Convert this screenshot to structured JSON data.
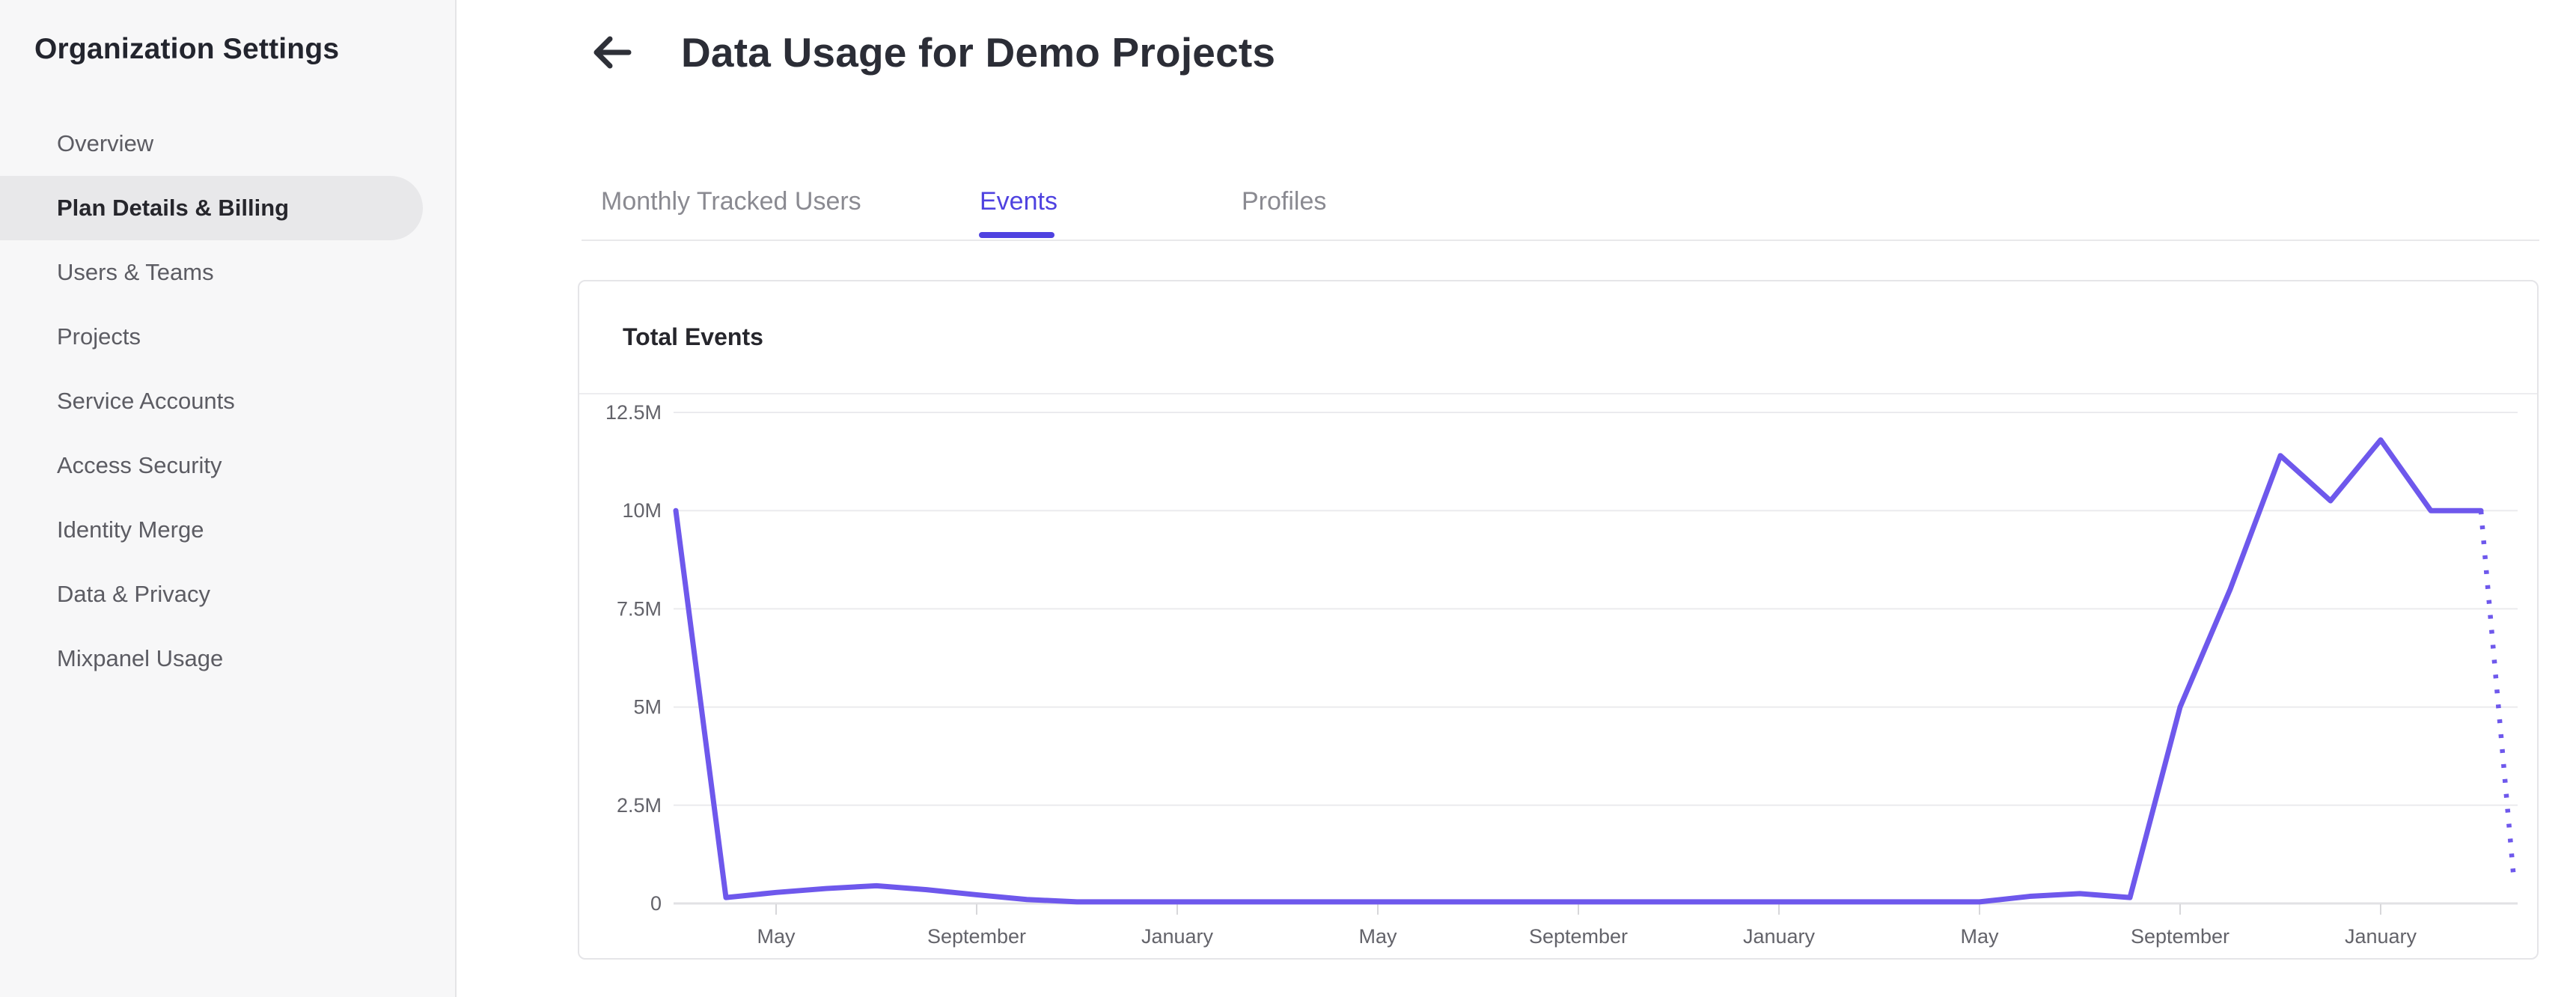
{
  "sidebar": {
    "title": "Organization Settings",
    "items": [
      {
        "label": "Overview",
        "selected": false
      },
      {
        "label": "Plan Details & Billing",
        "selected": true
      },
      {
        "label": "Users & Teams",
        "selected": false
      },
      {
        "label": "Projects",
        "selected": false
      },
      {
        "label": "Service Accounts",
        "selected": false
      },
      {
        "label": "Access Security",
        "selected": false
      },
      {
        "label": "Identity Merge",
        "selected": false
      },
      {
        "label": "Data & Privacy",
        "selected": false
      },
      {
        "label": "Mixpanel Usage",
        "selected": false
      }
    ]
  },
  "header": {
    "title": "Data Usage for Demo Projects",
    "back_icon": "left-arrow"
  },
  "tabs": [
    {
      "label": "Monthly Tracked Users",
      "active": false
    },
    {
      "label": "Events",
      "active": true
    },
    {
      "label": "Profiles",
      "active": false
    }
  ],
  "card": {
    "title": "Total Events"
  },
  "colors": {
    "accent": "#4f42e0",
    "line": "#6e58ec",
    "gridline": "#ebebee",
    "axis_line": "#e1e1e4",
    "tick": "#d7d7da",
    "axis_text": "#63636a"
  },
  "chart_data": {
    "type": "line",
    "title": "Total Events",
    "series_name": "Total Events",
    "unit": "events",
    "ylim": [
      0,
      12500000
    ],
    "grid": "horizontal",
    "legend": "none",
    "y_tick_labels": [
      "12.5M",
      "10M",
      "7.5M",
      "5M",
      "2.5M",
      "0"
    ],
    "y_tick_values_millions": [
      12.5,
      10,
      7.5,
      5,
      2.5,
      0
    ],
    "x_tick_labels": [
      "May",
      "September",
      "January",
      "May",
      "September",
      "January",
      "May",
      "September",
      "January"
    ],
    "x_tick_indices": [
      2,
      6,
      10,
      14,
      18,
      22,
      26,
      30,
      34
    ],
    "x_months": [
      "March",
      "April",
      "May",
      "June",
      "July",
      "August",
      "September",
      "October",
      "November",
      "December",
      "January",
      "February",
      "March",
      "April",
      "May",
      "June",
      "July",
      "August",
      "September",
      "October",
      "November",
      "December",
      "January",
      "February",
      "March",
      "April",
      "May",
      "June",
      "July",
      "August",
      "September",
      "October",
      "November",
      "December",
      "January",
      "February",
      "March",
      "April"
    ],
    "values_millions": [
      10.0,
      0.15,
      0.28,
      0.38,
      0.45,
      0.35,
      0.22,
      0.1,
      0.04,
      0.04,
      0.04,
      0.04,
      0.04,
      0.04,
      0.04,
      0.04,
      0.04,
      0.04,
      0.04,
      0.04,
      0.04,
      0.04,
      0.04,
      0.04,
      0.04,
      0.04,
      0.04,
      0.18,
      0.25,
      0.15,
      5.0,
      8.0,
      11.4,
      10.25,
      11.8,
      10.0,
      10.0,
      0.7
    ],
    "last_point_projected_dotted": true
  }
}
